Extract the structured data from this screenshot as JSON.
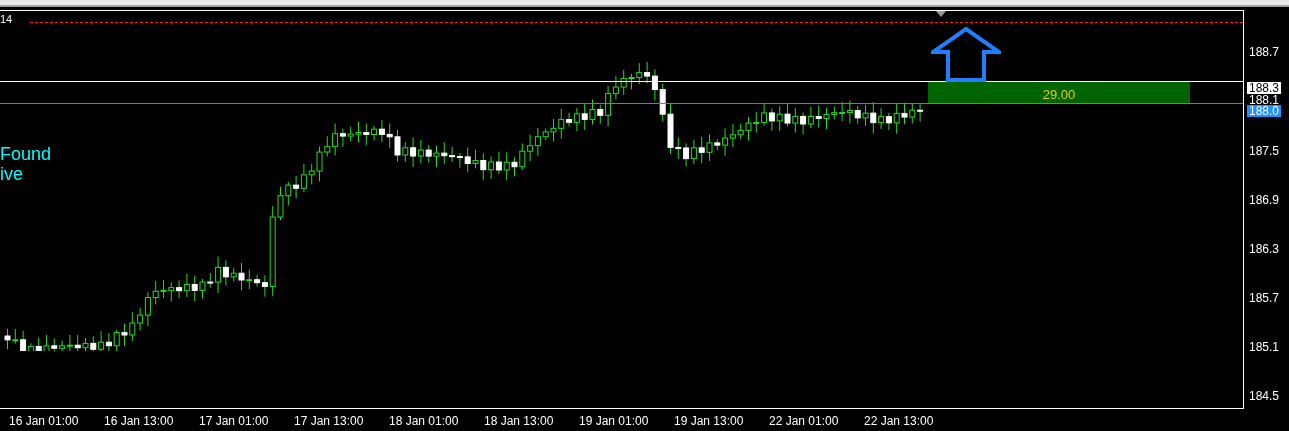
{
  "chart": {
    "level_label": "14",
    "indicator_lines": [
      "Found",
      "ive"
    ],
    "position_box": {
      "label": "29.00"
    },
    "price_ticks": [
      "188.7",
      "187.5",
      "186.9",
      "186.3",
      "185.7",
      "185.1",
      "184.5"
    ],
    "price_markers": [
      {
        "label": "188.3",
        "kind": "highlight"
      },
      {
        "label": "188.1",
        "kind": "plain"
      },
      {
        "label": "188.0",
        "kind": "line"
      }
    ],
    "time_ticks": [
      "16 Jan 01:00",
      "16 Jan 13:00",
      "17 Jan 01:00",
      "17 Jan 13:00",
      "18 Jan 01:00",
      "18 Jan 13:00",
      "19 Jan 01:00",
      "19 Jan 13:00",
      "22 Jan 01:00",
      "22 Jan 13:00"
    ]
  }
}
